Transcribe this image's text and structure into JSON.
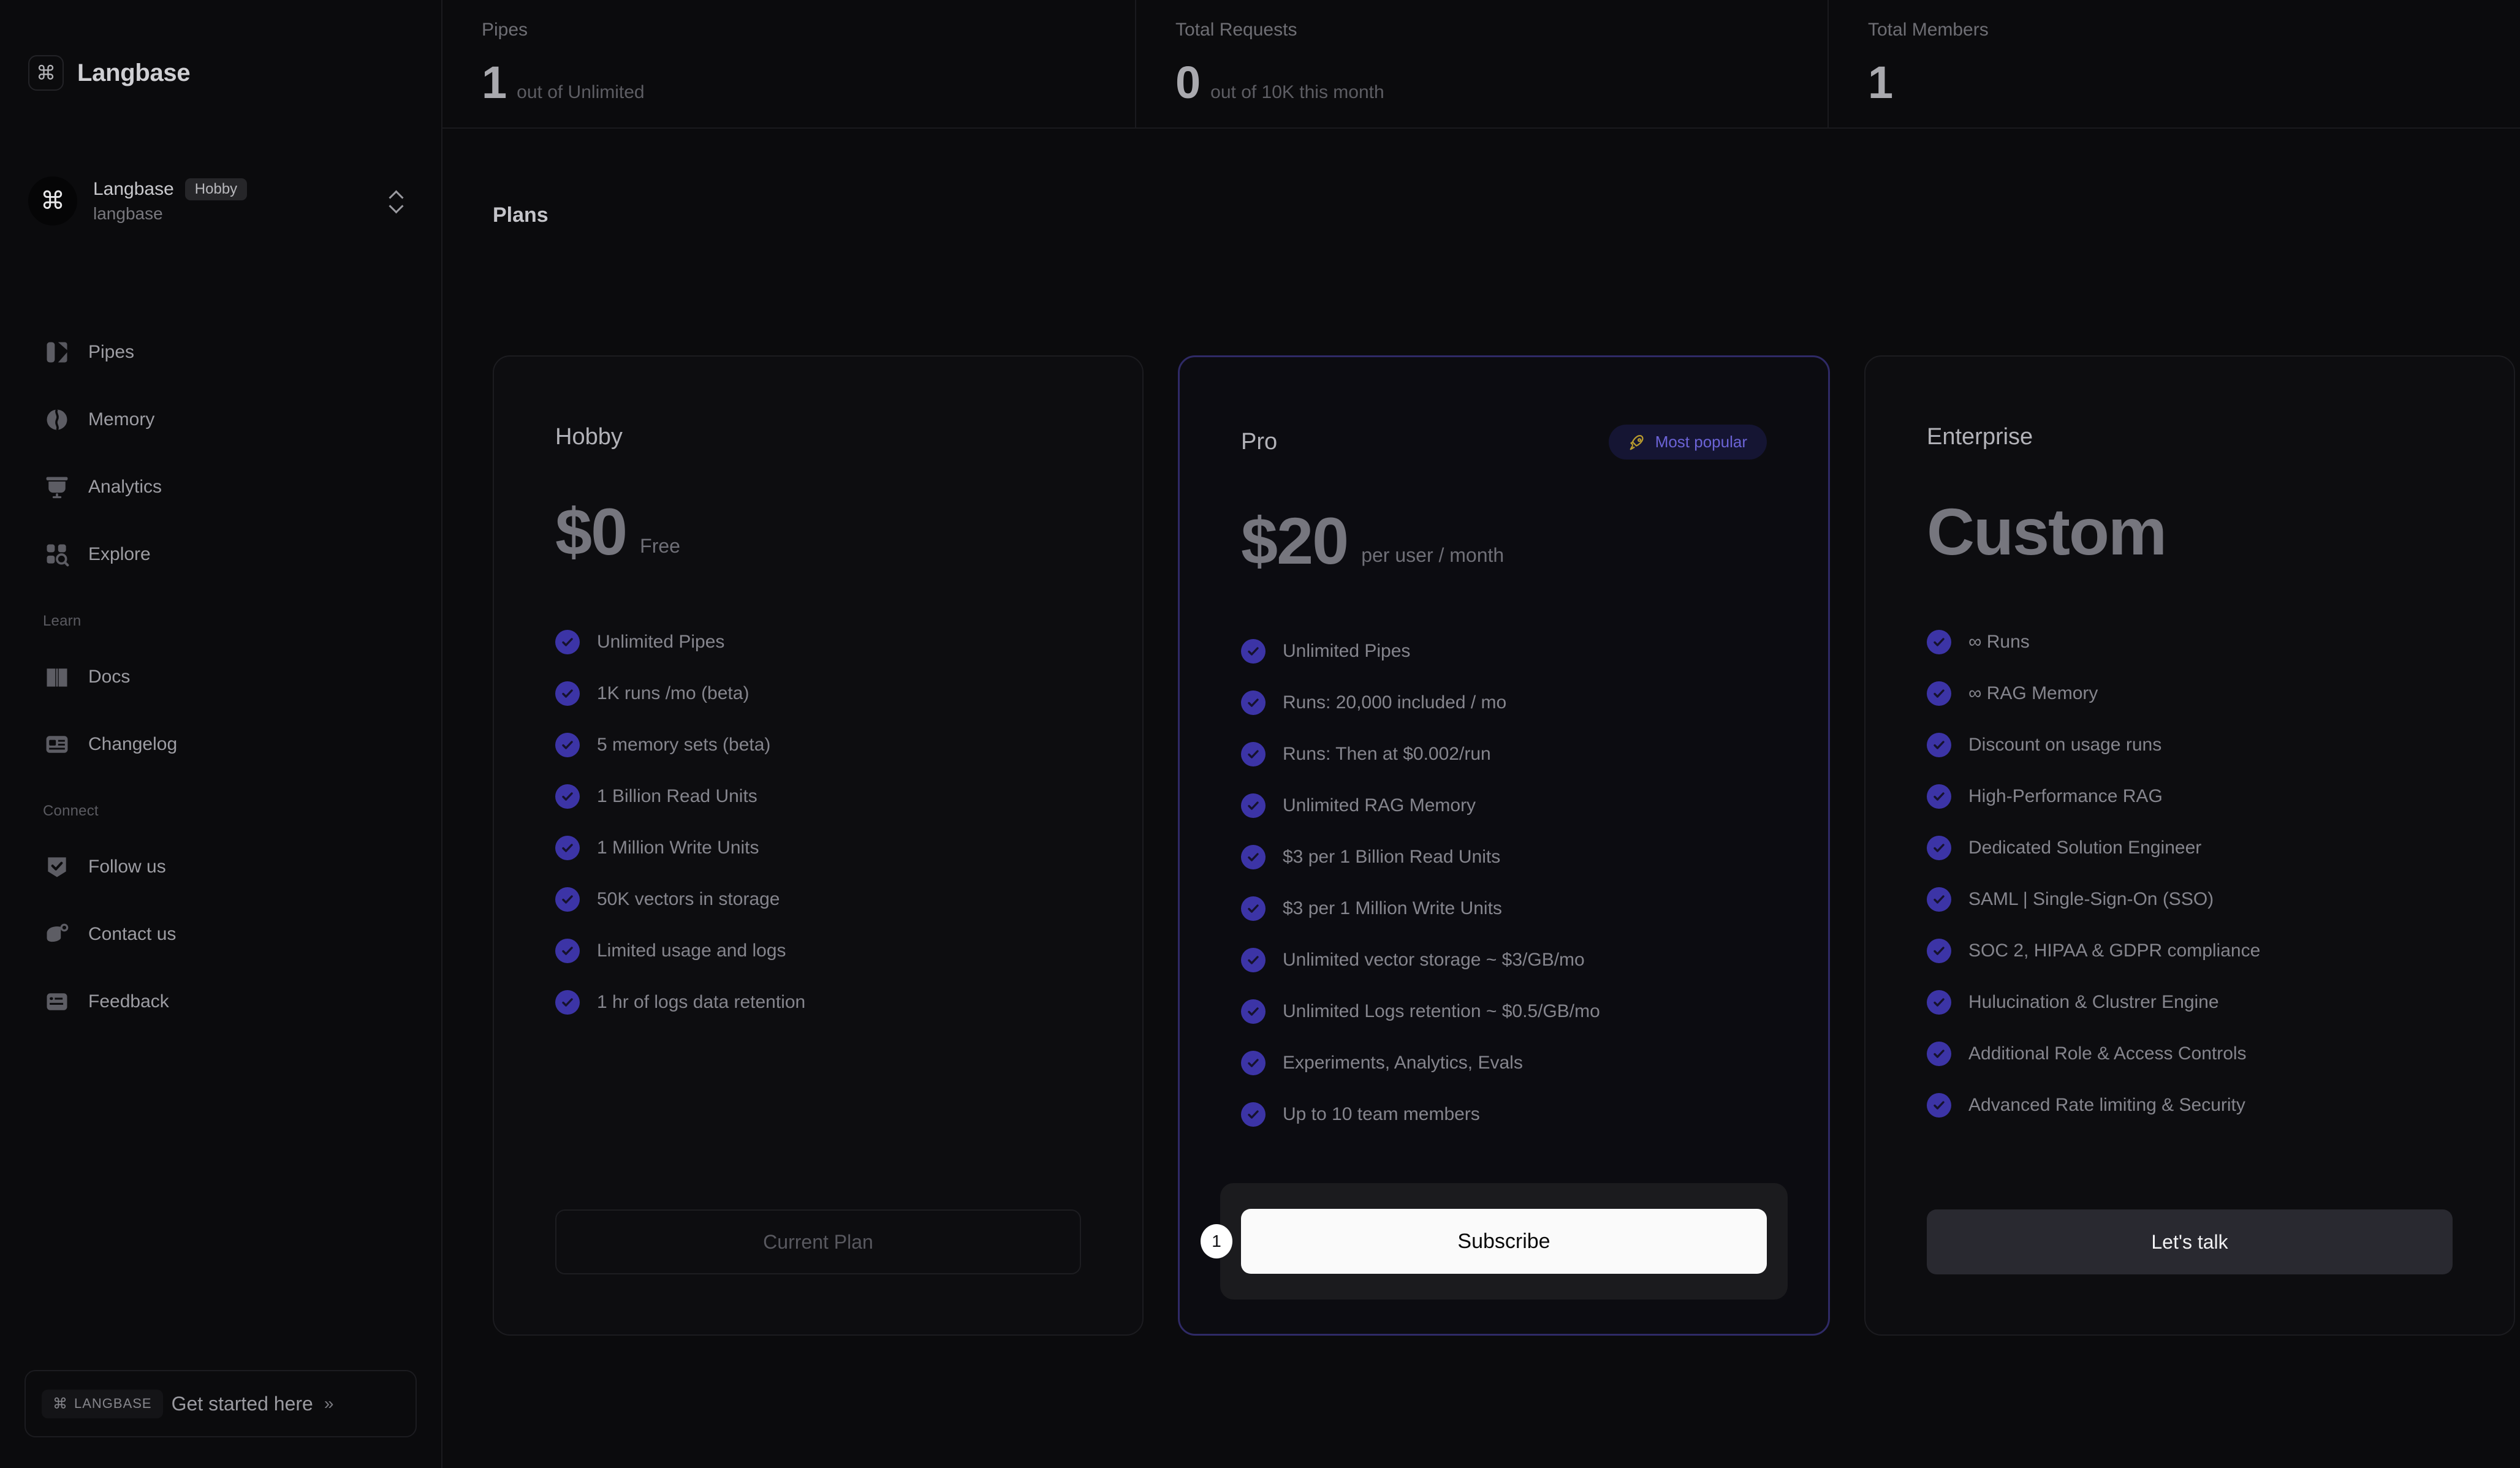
{
  "sidebar": {
    "brand": {
      "name": "Langbase",
      "mark_icon": "command-icon"
    },
    "org": {
      "avatar_icon": "command-icon",
      "name": "Langbase",
      "badge": "Hobby",
      "handle": "langbase"
    },
    "nav_primary": [
      {
        "label": "Pipes",
        "icon": "pipes-icon"
      },
      {
        "label": "Memory",
        "icon": "memory-icon"
      },
      {
        "label": "Analytics",
        "icon": "analytics-icon"
      },
      {
        "label": "Explore",
        "icon": "explore-icon"
      }
    ],
    "learn_title": "Learn",
    "nav_learn": [
      {
        "label": "Docs",
        "icon": "book-icon"
      },
      {
        "label": "Changelog",
        "icon": "changelog-icon"
      }
    ],
    "connect_title": "Connect",
    "nav_connect": [
      {
        "label": "Follow us",
        "icon": "badge-check-icon"
      },
      {
        "label": "Contact us",
        "icon": "contact-icon"
      },
      {
        "label": "Feedback",
        "icon": "feedback-icon"
      }
    ],
    "cta": {
      "chip_cmd": "⌘",
      "chip_label": "LANGBASE",
      "text": "Get started here",
      "arrow": "»"
    }
  },
  "stats": [
    {
      "label": "Pipes",
      "value": "1",
      "sub": "out of Unlimited"
    },
    {
      "label": "Total Requests",
      "value": "0",
      "sub": "out of 10K this month"
    },
    {
      "label": "Total Members",
      "value": "1",
      "sub": ""
    }
  ],
  "plans_heading": "Plans",
  "plans": [
    {
      "title": "Hobby",
      "price": "$0",
      "price_note": "Free",
      "badge": null,
      "features": [
        "Unlimited Pipes",
        "1K runs /mo (beta)",
        "5 memory sets (beta)",
        "1 Billion Read Units",
        "1 Million Write Units",
        "50K vectors in storage",
        "Limited usage and logs",
        "1 hr of logs data retention"
      ],
      "cta_label": "Current Plan",
      "cta_style": "current"
    },
    {
      "title": "Pro",
      "price": "$20",
      "price_note": "per user / month",
      "badge": {
        "label": "Most popular",
        "icon": "rocket-icon"
      },
      "features": [
        "Unlimited Pipes",
        "Runs: 20,000 included / mo",
        "Runs: Then at $0.002/run",
        "Unlimited RAG Memory",
        "$3 per 1 Billion Read Units",
        "$3 per 1 Million Write Units",
        "Unlimited vector storage ~ $3/GB/mo",
        "Unlimited Logs retention ~ $0.5/GB/mo",
        "Experiments, Analytics, Evals",
        "Up to 10 team members"
      ],
      "cta_label": "Subscribe",
      "cta_style": "subscribe",
      "marker": "1"
    },
    {
      "title": "Enterprise",
      "price": "Custom",
      "price_note": "",
      "badge": null,
      "features": [
        "∞ Runs",
        "∞ RAG Memory",
        "Discount on usage runs",
        "High-Performance RAG",
        "Dedicated Solution Engineer",
        "SAML | Single-Sign-On (SSO)",
        "SOC 2, HIPAA & GDPR compliance",
        "Hulucination & Clustrer Engine",
        "Additional Role & Access Controls",
        "Advanced Rate limiting & Security"
      ],
      "cta_label": "Let's talk",
      "cta_style": "talk"
    }
  ],
  "colors": {
    "background": "#0b0b0d",
    "card_border": "#1c1c20",
    "featured_border": "#2f2a66",
    "check_circle": "#3c34a6",
    "badge_text": "#6b63d6",
    "rocket": "#b99b2e",
    "subscribe_bg": "#fafafa"
  }
}
